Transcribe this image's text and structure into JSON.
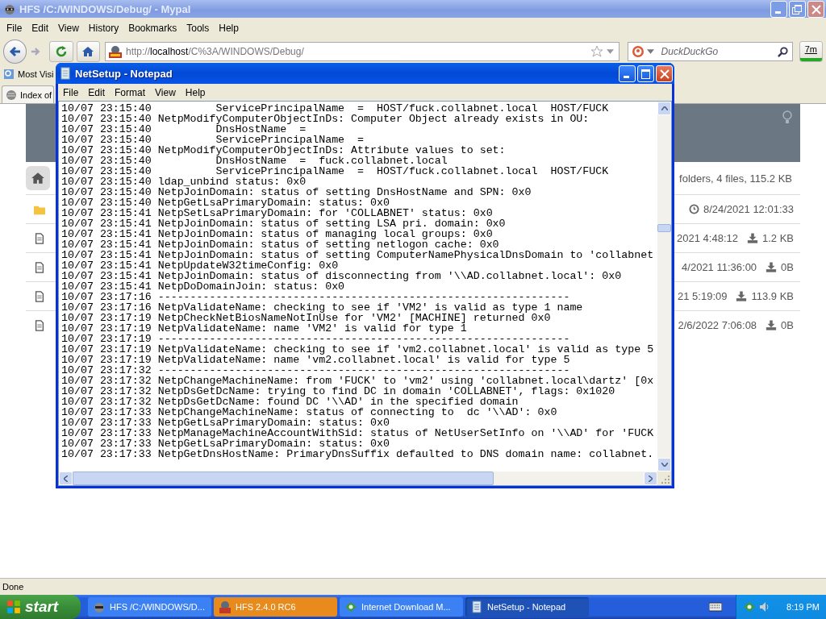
{
  "browser": {
    "title": "HFS /C:/WINDOWS/Debug/ - Mypal",
    "menu": [
      "File",
      "Edit",
      "View",
      "History",
      "Bookmarks",
      "Tools",
      "Help"
    ],
    "address": "http://**localhost**/C%3A/WINDOWS/Debug/",
    "search": {
      "placeholder": "DuckDuckGo"
    },
    "addon_badge": "7m",
    "bookmarks": [
      "Most Visi"
    ],
    "tabs": [
      {
        "label": "Index of",
        "selected": true
      }
    ],
    "page": {
      "summary": "folders, 4 files, 115.2 KB",
      "rows": [
        {
          "kind": "folder",
          "date": "8/24/2021 12:01:33"
        },
        {
          "kind": "file",
          "date": "2021 4:48:12",
          "size": "1.2 KB"
        },
        {
          "kind": "file",
          "date": "4/2021 11:36:00",
          "size": "0B"
        },
        {
          "kind": "file",
          "date": "21 5:19:09",
          "size": "113.9 KB"
        },
        {
          "kind": "file",
          "date": "2/6/2022 7:06:08",
          "size": "0B"
        }
      ]
    },
    "status_bar": "Done"
  },
  "notepad": {
    "title": "NetSetup - Notepad",
    "menu": [
      "File",
      "Edit",
      "Format",
      "View",
      "Help"
    ],
    "lines": [
      "10/07 23:15:40          ServicePrincipalName  =  HOST/fuck.collabnet.local  HOST/FUCK",
      "10/07 23:15:40 NetpModifyComputerObjectInDs: Computer Object already exists in OU:",
      "10/07 23:15:40          DnsHostName  =",
      "10/07 23:15:40          ServicePrincipalName  =",
      "10/07 23:15:40 NetpModifyComputerObjectInDs: Attribute values to set:",
      "10/07 23:15:40          DnsHostName  =  fuck.collabnet.local",
      "10/07 23:15:40          ServicePrincipalName  =  HOST/fuck.collabnet.local  HOST/FUCK",
      "10/07 23:15:40 ldap_unbind status: 0x0",
      "10/07 23:15:40 NetpJoinDomain: status of setting DnsHostName and SPN: 0x0",
      "10/07 23:15:40 NetpGetLsaPrimaryDomain: status: 0x0",
      "10/07 23:15:41 NetpSetLsaPrimaryDomain: for 'COLLABNET' status: 0x0",
      "10/07 23:15:41 NetpJoinDomain: status of setting LSA pri. domain: 0x0",
      "10/07 23:15:41 NetpJoinDomain: status of managing local groups: 0x0",
      "10/07 23:15:41 NetpJoinDomain: status of setting netlogon cache: 0x0",
      "10/07 23:15:41 NetpJoinDomain: status of setting ComputerNamePhysicalDnsDomain to 'collabnet",
      "10/07 23:15:41 NetpUpdateW32timeConfig: 0x0",
      "10/07 23:15:41 NetpJoinDomain: status of disconnecting from '\\\\AD.collabnet.local': 0x0",
      "10/07 23:15:41 NetpDoDomainJoin: status: 0x0",
      "10/07 23:17:16 ----------------------------------------------------------------",
      "10/07 23:17:16 NetpValidateName: checking to see if 'VM2' is valid as type 1 name",
      "10/07 23:17:19 NetpCheckNetBiosNameNotInUse for 'VM2' [MACHINE] returned 0x0",
      "10/07 23:17:19 NetpValidateName: name 'VM2' is valid for type 1",
      "10/07 23:17:19 ----------------------------------------------------------------",
      "10/07 23:17:19 NetpValidateName: checking to see if 'vm2.collabnet.local' is valid as type 5",
      "10/07 23:17:19 NetpValidateName: name 'vm2.collabnet.local' is valid for type 5",
      "10/07 23:17:32 ----------------------------------------------------------------",
      "10/07 23:17:32 NetpChangeMachineName: from 'FUCK' to 'vm2' using 'collabnet.local\\dartz' [0x",
      "10/07 23:17:32 NetpDsGetDcName: trying to find DC in domain 'COLLABNET', flags: 0x1020",
      "10/07 23:17:32 NetpDsGetDcName: found DC '\\\\AD' in the specified domain",
      "10/07 23:17:33 NetpChangeMachineName: status of connecting to  dc '\\\\AD': 0x0",
      "10/07 23:17:33 NetpGetLsaPrimaryDomain: status: 0x0",
      "10/07 23:17:33 NetpManageMachineAccountWithSid: status of NetUserSetInfo on '\\\\AD' for 'FUCK",
      "10/07 23:17:33 NetpGetLsaPrimaryDomain: status: 0x0",
      "10/07 23:17:33 NetpGetDnsHostName: PrimaryDnsSuffix defaulted to DNS domain name: collabnet."
    ]
  },
  "taskbar": {
    "start": "start",
    "tasks": [
      {
        "label": "HFS /C:/WINDOWS/D...",
        "selected": false,
        "attention": false
      },
      {
        "label": "HFS 2.4.0 RC6",
        "selected": false,
        "attention": true
      },
      {
        "label": "Internet Download M...",
        "selected": false,
        "attention": false
      },
      {
        "label": "NetSetup - Notepad",
        "selected": true,
        "attention": false
      }
    ],
    "clock": "8:19 PM"
  }
}
